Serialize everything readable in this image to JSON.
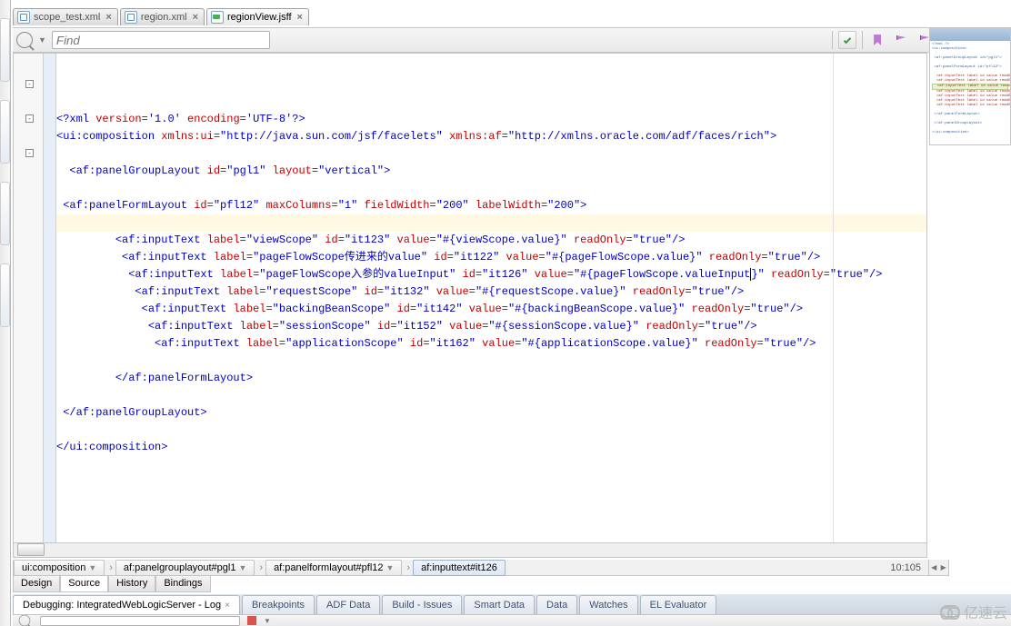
{
  "fileTabs": [
    {
      "name": "scope_test.xml",
      "iconType": "xml",
      "active": false
    },
    {
      "name": "region.xml",
      "iconType": "xml",
      "active": false
    },
    {
      "name": "regionView.jsff",
      "iconType": "jsff",
      "active": true
    }
  ],
  "findbar": {
    "placeholder": "Find"
  },
  "cursorPos": "10:105",
  "breadcrumb": [
    {
      "label": "ui:composition",
      "selected": false
    },
    {
      "label": "af:panelgrouplayout#pgl1",
      "selected": false
    },
    {
      "label": "af:panelformlayout#pfl12",
      "selected": false
    },
    {
      "label": "af:inputtext#it126",
      "selected": true
    }
  ],
  "viewTabs": [
    {
      "label": "Design",
      "selected": false
    },
    {
      "label": "Source",
      "selected": true
    },
    {
      "label": "History",
      "selected": false
    },
    {
      "label": "Bindings",
      "selected": false
    }
  ],
  "debugTabs": [
    {
      "label": "Debugging: IntegratedWebLogicServer - Log",
      "selected": true,
      "closable": true
    },
    {
      "label": "Breakpoints",
      "selected": false
    },
    {
      "label": "ADF Data",
      "selected": false
    },
    {
      "label": "Build - Issues",
      "selected": false
    },
    {
      "label": "Smart Data",
      "selected": false
    },
    {
      "label": "Data",
      "selected": false
    },
    {
      "label": "Watches",
      "selected": false
    },
    {
      "label": "EL Evaluator",
      "selected": false
    }
  ],
  "code": {
    "highlightLine": 10,
    "foldMarks": [
      {
        "line": 2,
        "glyph": "-"
      },
      {
        "line": 4,
        "glyph": "-"
      },
      {
        "line": 6,
        "glyph": "-"
      }
    ],
    "lines": [
      {
        "indent": 0,
        "tokens": [
          {
            "c": "t-tag",
            "t": "<?xml "
          },
          {
            "c": "t-attr",
            "t": "version"
          },
          {
            "c": "t-text",
            "t": "="
          },
          {
            "c": "t-str",
            "t": "'1.0'"
          },
          {
            "c": "t-attr",
            "t": " encoding"
          },
          {
            "c": "t-text",
            "t": "="
          },
          {
            "c": "t-str",
            "t": "'UTF-8'"
          },
          {
            "c": "t-tag",
            "t": "?>"
          }
        ]
      },
      {
        "indent": 0,
        "tokens": [
          {
            "c": "t-tag",
            "t": "<ui:composition "
          },
          {
            "c": "t-attr",
            "t": "xmlns:ui"
          },
          {
            "c": "t-text",
            "t": "="
          },
          {
            "c": "t-str",
            "t": "\"http://java.sun.com/jsf/facelets\""
          },
          {
            "c": "t-attr",
            "t": " xmlns:af"
          },
          {
            "c": "t-text",
            "t": "="
          },
          {
            "c": "t-str",
            "t": "\"http://xmlns.oracle.com/adf/faces/rich\""
          },
          {
            "c": "t-tag",
            "t": ">"
          }
        ]
      },
      {
        "indent": 0,
        "tokens": []
      },
      {
        "indent": 2,
        "tokens": [
          {
            "c": "t-tag",
            "t": "<af:panelGroupLayout "
          },
          {
            "c": "t-attr",
            "t": "id"
          },
          {
            "c": "t-text",
            "t": "="
          },
          {
            "c": "t-str",
            "t": "\"pgl1\""
          },
          {
            "c": "t-attr",
            "t": " layout"
          },
          {
            "c": "t-text",
            "t": "="
          },
          {
            "c": "t-str",
            "t": "\"vertical\""
          },
          {
            "c": "t-tag",
            "t": ">"
          }
        ]
      },
      {
        "indent": 0,
        "tokens": []
      },
      {
        "indent": 1,
        "tokens": [
          {
            "c": "t-tag",
            "t": "<af:panelFormLayout "
          },
          {
            "c": "t-attr",
            "t": "id"
          },
          {
            "c": "t-text",
            "t": "="
          },
          {
            "c": "t-str",
            "t": "\"pfl12\""
          },
          {
            "c": "t-attr",
            "t": " maxColumns"
          },
          {
            "c": "t-text",
            "t": "="
          },
          {
            "c": "t-str",
            "t": "\"1\""
          },
          {
            "c": "t-attr",
            "t": " fieldWidth"
          },
          {
            "c": "t-text",
            "t": "="
          },
          {
            "c": "t-str",
            "t": "\"200\""
          },
          {
            "c": "t-attr",
            "t": " labelWidth"
          },
          {
            "c": "t-text",
            "t": "="
          },
          {
            "c": "t-str",
            "t": "\"200\""
          },
          {
            "c": "t-tag",
            "t": ">"
          }
        ]
      },
      {
        "indent": 0,
        "tokens": []
      },
      {
        "indent": 9,
        "tokens": [
          {
            "c": "t-tag",
            "t": "<af:inputText "
          },
          {
            "c": "t-attr",
            "t": "label"
          },
          {
            "c": "t-text",
            "t": "="
          },
          {
            "c": "t-str",
            "t": "\"viewScope\""
          },
          {
            "c": "t-attr",
            "t": " id"
          },
          {
            "c": "t-text",
            "t": "="
          },
          {
            "c": "t-str",
            "t": "\"it123\""
          },
          {
            "c": "t-attr",
            "t": " value"
          },
          {
            "c": "t-text",
            "t": "="
          },
          {
            "c": "t-str",
            "t": "\"#{viewScope.value}\""
          },
          {
            "c": "t-attr",
            "t": " readOnly"
          },
          {
            "c": "t-text",
            "t": "="
          },
          {
            "c": "t-str",
            "t": "\"true\""
          },
          {
            "c": "t-tag",
            "t": "/>"
          }
        ]
      },
      {
        "indent": 10,
        "tokens": [
          {
            "c": "t-tag",
            "t": "<af:inputText "
          },
          {
            "c": "t-attr",
            "t": "label"
          },
          {
            "c": "t-text",
            "t": "="
          },
          {
            "c": "t-str",
            "t": "\"pageFlowScope传进来的value\""
          },
          {
            "c": "t-attr",
            "t": " id"
          },
          {
            "c": "t-text",
            "t": "="
          },
          {
            "c": "t-str",
            "t": "\"it122\""
          },
          {
            "c": "t-attr",
            "t": " value"
          },
          {
            "c": "t-text",
            "t": "="
          },
          {
            "c": "t-str",
            "t": "\"#{pageFlowScope.value}\""
          },
          {
            "c": "t-attr",
            "t": " readOnly"
          },
          {
            "c": "t-text",
            "t": "="
          },
          {
            "c": "t-str",
            "t": "\"true\""
          },
          {
            "c": "t-tag",
            "t": "/>"
          }
        ]
      },
      {
        "indent": 11,
        "tokens": [
          {
            "c": "t-tag",
            "t": "<af:inputText "
          },
          {
            "c": "t-attr",
            "t": "label"
          },
          {
            "c": "t-text",
            "t": "="
          },
          {
            "c": "t-str",
            "t": "\"pageFlowScope入参的valueInput\""
          },
          {
            "c": "t-attr",
            "t": " id"
          },
          {
            "c": "t-text",
            "t": "="
          },
          {
            "c": "t-str",
            "t": "\"it126\""
          },
          {
            "c": "t-attr",
            "t": " value"
          },
          {
            "c": "t-text",
            "t": "="
          },
          {
            "c": "t-str",
            "t": "\"#{pageFlowScope.valueInput"
          },
          {
            "c": "cursor",
            "t": ""
          },
          {
            "c": "t-str",
            "t": "}\""
          },
          {
            "c": "t-attr",
            "t": " readOnly"
          },
          {
            "c": "t-text",
            "t": "="
          },
          {
            "c": "t-str",
            "t": "\"true\""
          },
          {
            "c": "t-tag",
            "t": "/>"
          }
        ]
      },
      {
        "indent": 12,
        "tokens": [
          {
            "c": "t-tag",
            "t": "<af:inputText "
          },
          {
            "c": "t-attr",
            "t": "label"
          },
          {
            "c": "t-text",
            "t": "="
          },
          {
            "c": "t-str",
            "t": "\"requestScope\""
          },
          {
            "c": "t-attr",
            "t": " id"
          },
          {
            "c": "t-text",
            "t": "="
          },
          {
            "c": "t-str",
            "t": "\"it132\""
          },
          {
            "c": "t-attr",
            "t": " value"
          },
          {
            "c": "t-text",
            "t": "="
          },
          {
            "c": "t-str",
            "t": "\"#{requestScope.value}\""
          },
          {
            "c": "t-attr",
            "t": " readOnly"
          },
          {
            "c": "t-text",
            "t": "="
          },
          {
            "c": "t-str",
            "t": "\"true\""
          },
          {
            "c": "t-tag",
            "t": "/>"
          }
        ]
      },
      {
        "indent": 13,
        "tokens": [
          {
            "c": "t-tag",
            "t": "<af:inputText "
          },
          {
            "c": "t-attr",
            "t": "label"
          },
          {
            "c": "t-text",
            "t": "="
          },
          {
            "c": "t-str",
            "t": "\"backingBeanScope\""
          },
          {
            "c": "t-attr",
            "t": " id"
          },
          {
            "c": "t-text",
            "t": "="
          },
          {
            "c": "t-str",
            "t": "\"it142\""
          },
          {
            "c": "t-attr",
            "t": " value"
          },
          {
            "c": "t-text",
            "t": "="
          },
          {
            "c": "t-str",
            "t": "\"#{backingBeanScope.value}\""
          },
          {
            "c": "t-attr",
            "t": " readOnly"
          },
          {
            "c": "t-text",
            "t": "="
          },
          {
            "c": "t-str",
            "t": "\"true\""
          },
          {
            "c": "t-tag",
            "t": "/>"
          }
        ]
      },
      {
        "indent": 14,
        "tokens": [
          {
            "c": "t-tag",
            "t": "<af:inputText "
          },
          {
            "c": "t-attr",
            "t": "label"
          },
          {
            "c": "t-text",
            "t": "="
          },
          {
            "c": "t-str",
            "t": "\"sessionScope\""
          },
          {
            "c": "t-attr",
            "t": " id"
          },
          {
            "c": "t-text",
            "t": "="
          },
          {
            "c": "t-str",
            "t": "\"it152\""
          },
          {
            "c": "t-attr",
            "t": " value"
          },
          {
            "c": "t-text",
            "t": "="
          },
          {
            "c": "t-str",
            "t": "\"#{sessionScope.value}\""
          },
          {
            "c": "t-attr",
            "t": " readOnly"
          },
          {
            "c": "t-text",
            "t": "="
          },
          {
            "c": "t-str",
            "t": "\"true\""
          },
          {
            "c": "t-tag",
            "t": "/>"
          }
        ]
      },
      {
        "indent": 15,
        "tokens": [
          {
            "c": "t-tag",
            "t": "<af:inputText "
          },
          {
            "c": "t-attr",
            "t": "label"
          },
          {
            "c": "t-text",
            "t": "="
          },
          {
            "c": "t-str",
            "t": "\"applicationScope\""
          },
          {
            "c": "t-attr",
            "t": " id"
          },
          {
            "c": "t-text",
            "t": "="
          },
          {
            "c": "t-str",
            "t": "\"it162\""
          },
          {
            "c": "t-attr",
            "t": " value"
          },
          {
            "c": "t-text",
            "t": "="
          },
          {
            "c": "t-str",
            "t": "\"#{applicationScope.value}\""
          },
          {
            "c": "t-attr",
            "t": " readOnly"
          },
          {
            "c": "t-text",
            "t": "="
          },
          {
            "c": "t-str",
            "t": "\"true\""
          },
          {
            "c": "t-tag",
            "t": "/>"
          }
        ]
      },
      {
        "indent": 0,
        "tokens": []
      },
      {
        "indent": 9,
        "tokens": [
          {
            "c": "t-tag",
            "t": "</af:panelFormLayout>"
          }
        ]
      },
      {
        "indent": 0,
        "tokens": []
      },
      {
        "indent": 1,
        "tokens": [
          {
            "c": "t-tag",
            "t": "</af:panelGroupLayout>"
          }
        ]
      },
      {
        "indent": 0,
        "tokens": []
      },
      {
        "indent": 0,
        "tokens": [
          {
            "c": "t-tag",
            "t": "</ui:composition>"
          }
        ]
      }
    ]
  },
  "watermark": "亿速云"
}
